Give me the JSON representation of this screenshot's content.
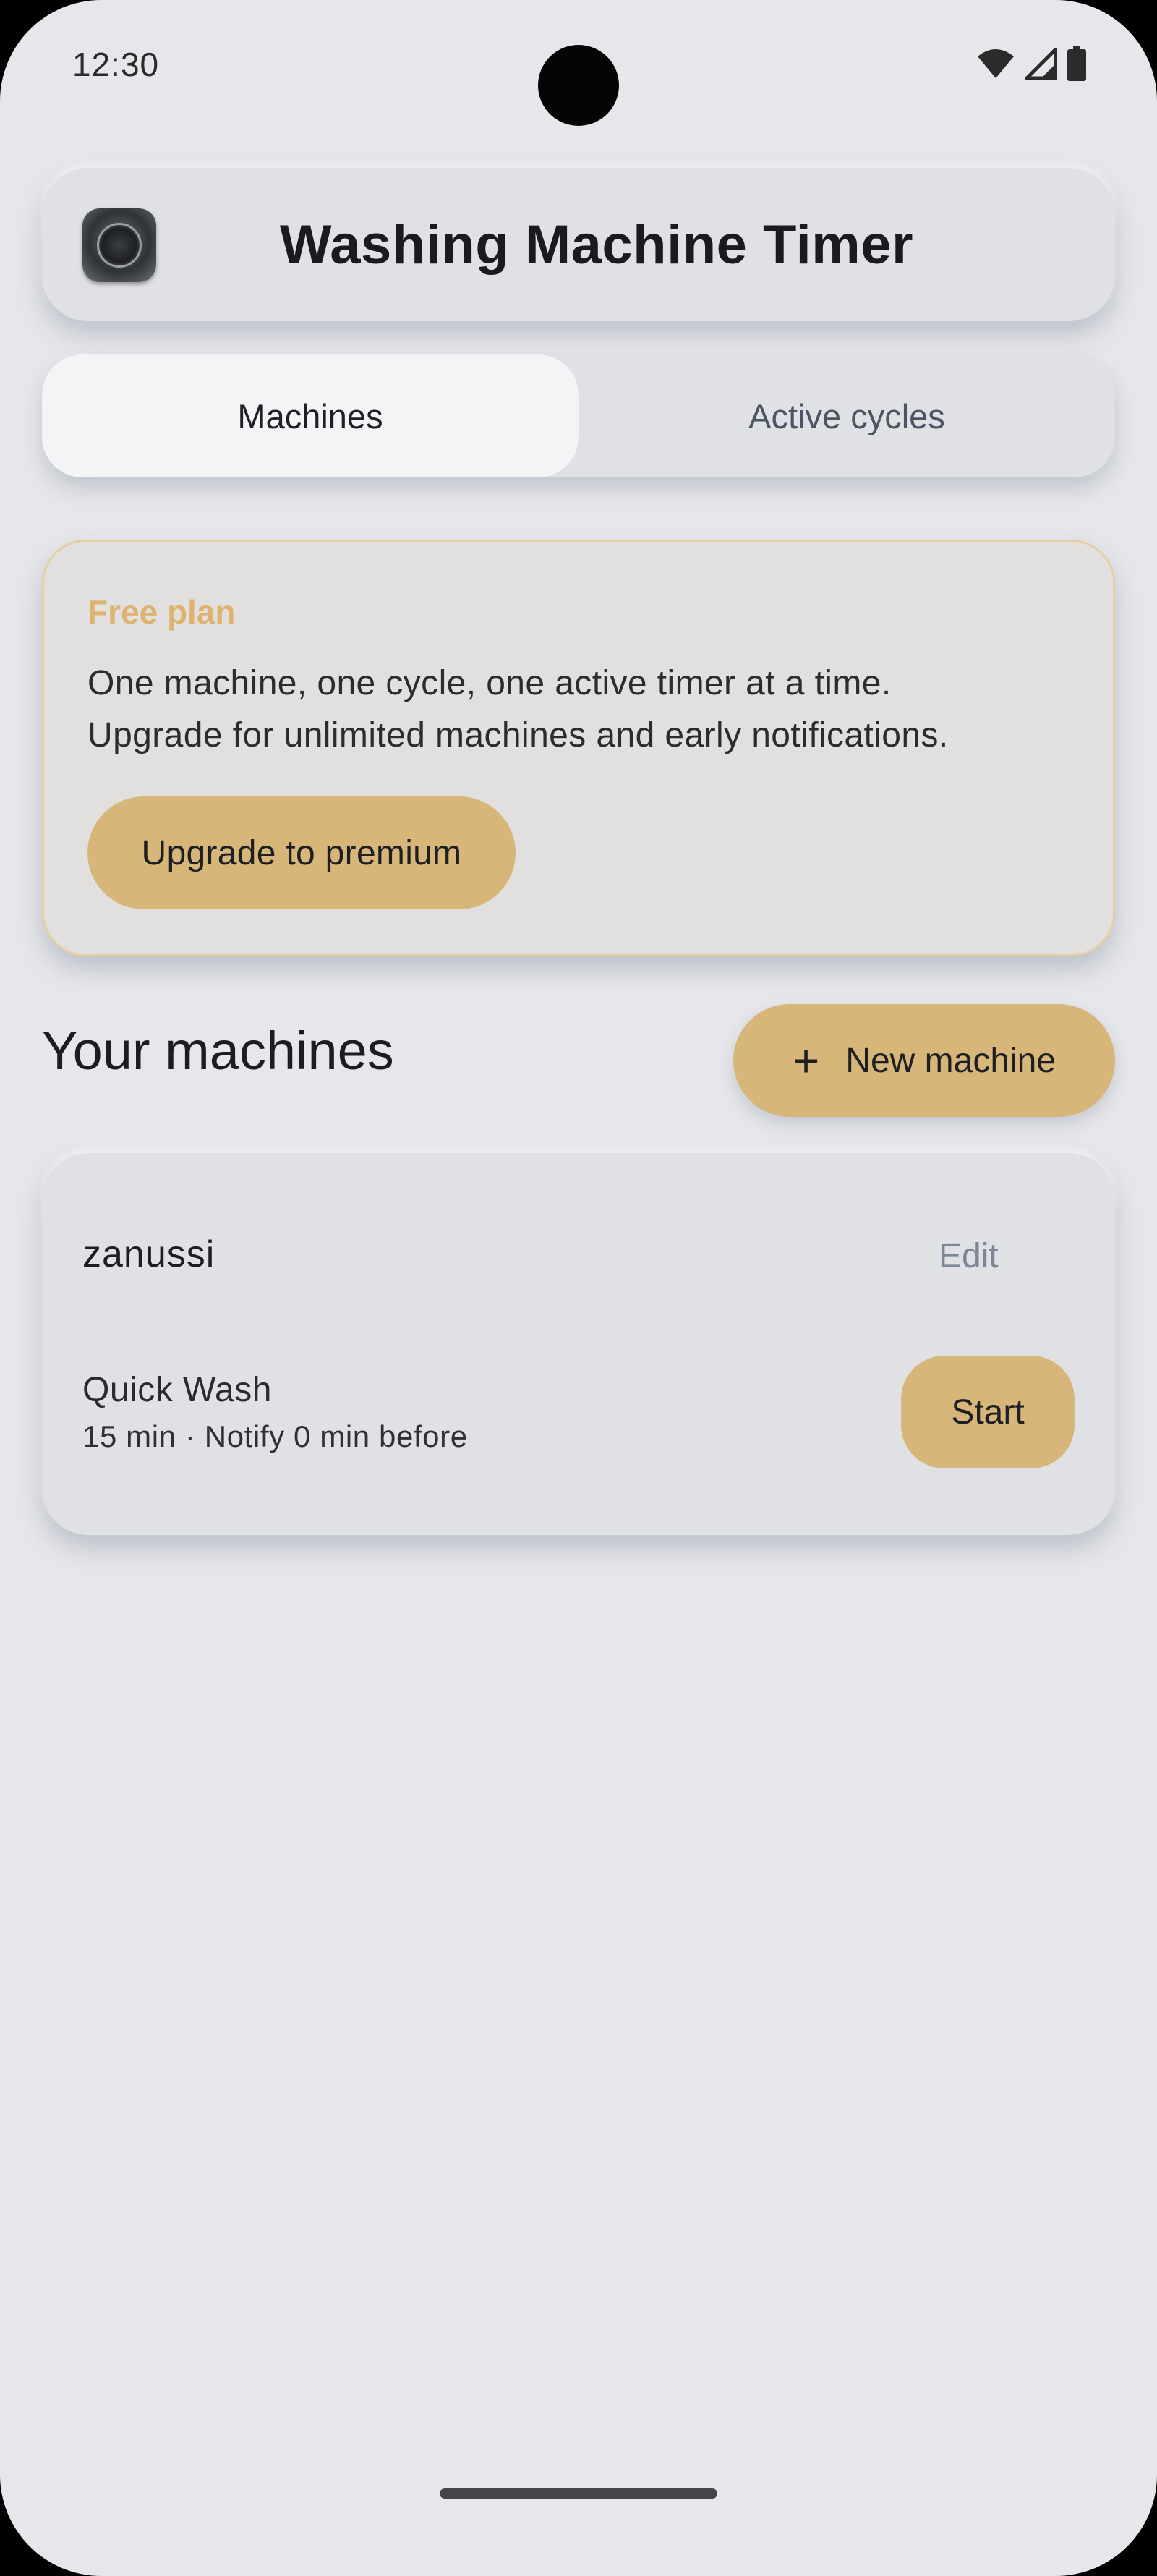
{
  "status_bar": {
    "time": "12:30",
    "icons": [
      "wifi-icon",
      "signal-icon",
      "battery-icon"
    ]
  },
  "header": {
    "title": "Washing Machine Timer",
    "logo_icon": "washing-machine-icon"
  },
  "tabs": [
    {
      "label": "Machines",
      "active": true
    },
    {
      "label": "Active cycles",
      "active": false
    }
  ],
  "promo": {
    "title": "Free plan",
    "line1": "One machine, one cycle, one active timer at a time.",
    "line2": "Upgrade for unlimited machines and early notifications.",
    "button_label": "Upgrade to premium"
  },
  "machines_section": {
    "title": "Your machines",
    "new_button_label": "New machine",
    "new_button_icon": "plus-icon"
  },
  "machines": [
    {
      "name": "zanussi",
      "edit_label": "Edit",
      "cycles": [
        {
          "name": "Quick Wash",
          "details": "15 min · Notify 0 min before",
          "start_label": "Start"
        }
      ]
    }
  ],
  "colors": {
    "background": "#e6e7ea",
    "accent": "#d6b679",
    "promo_title": "#ddb36f",
    "muted_text": "#7c8696"
  }
}
